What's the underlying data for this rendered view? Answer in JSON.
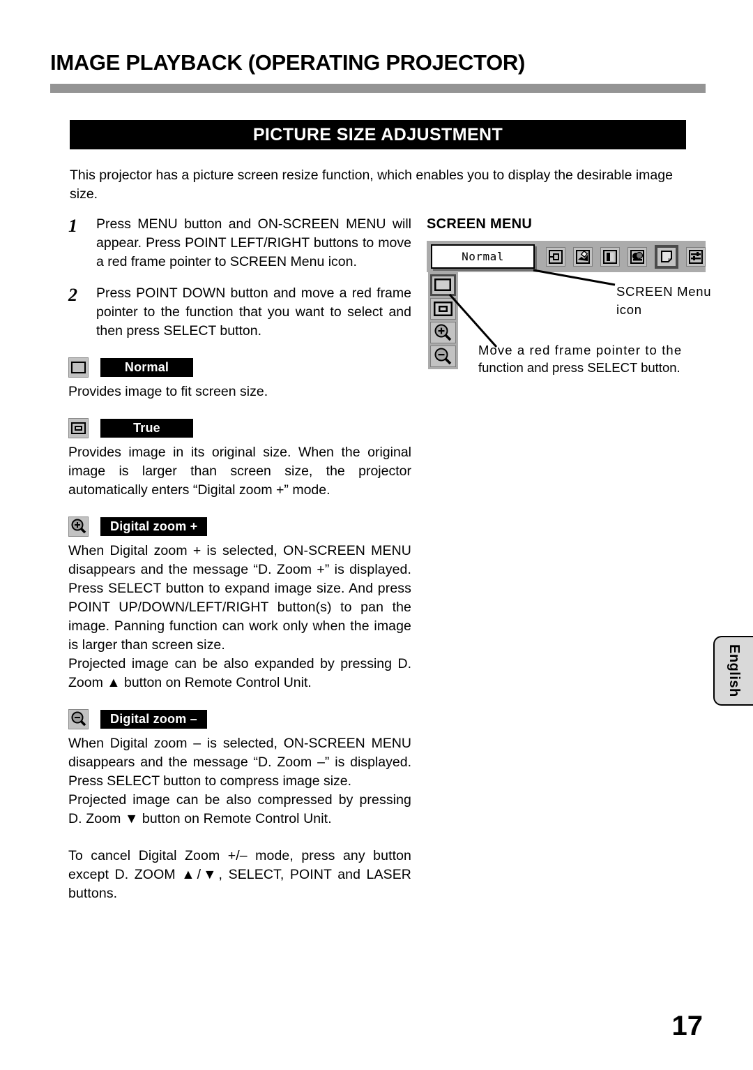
{
  "header": {
    "title": "IMAGE PLAYBACK (OPERATING PROJECTOR)",
    "section_banner": "PICTURE SIZE ADJUSTMENT"
  },
  "intro": "This projector has a picture screen resize function, which enables you to display the desirable image size.",
  "steps": [
    {
      "number": "1",
      "text": "Press MENU button and ON-SCREEN MENU will appear.  Press POINT LEFT/RIGHT buttons to move a red frame pointer to SCREEN Menu icon."
    },
    {
      "number": "2",
      "text": "Press POINT DOWN button and move a red frame pointer to the function that you want to select and then press SELECT button."
    }
  ],
  "functions": [
    {
      "icon": "normal-screen-icon",
      "badge": "Normal",
      "paragraphs": [
        "Provides image to fit screen size."
      ]
    },
    {
      "icon": "true-screen-icon",
      "badge": "True",
      "paragraphs": [
        "Provides image in its original size.  When the original image is larger than screen size, the projector automatically enters “Digital zoom +” mode."
      ]
    },
    {
      "icon": "digital-zoom-in-icon",
      "badge": "Digital zoom +",
      "paragraphs": [
        "When Digital zoom + is selected, ON-SCREEN MENU disappears and the message “D. Zoom +” is displayed.  Press SELECT button to expand image size.  And press POINT UP/DOWN/LEFT/RIGHT button(s) to pan the image.  Panning function can work only when the image is larger than screen size.",
        "Projected image can be also expanded by pressing D. Zoom ▲ button on Remote Control Unit."
      ]
    },
    {
      "icon": "digital-zoom-out-icon",
      "badge": "Digital zoom –",
      "paragraphs": [
        "When Digital zoom – is selected, ON-SCREEN MENU disappears and the message “D. Zoom –” is displayed.  Press SELECT button to compress image size.",
        "Projected image can be also compressed by pressing D. Zoom ▼ button on Remote Control Unit."
      ]
    }
  ],
  "closing_note": "To cancel Digital Zoom +/– mode, press any button except D. ZOOM ▲/▼, SELECT, POINT and LASER buttons.",
  "screen_menu_figure": {
    "label": "SCREEN MENU",
    "osd_value": "Normal",
    "menu_bar_icons": [
      {
        "name": "input-menu-icon",
        "selected": false
      },
      {
        "name": "image-adjust-menu-icon",
        "selected": false
      },
      {
        "name": "image-select-menu-icon",
        "selected": false
      },
      {
        "name": "pc-adjust-menu-icon",
        "selected": false
      },
      {
        "name": "screen-menu-icon",
        "selected": true
      },
      {
        "name": "setting-menu-icon",
        "selected": false
      }
    ],
    "submenu_icons": [
      {
        "name": "normal-screen-icon",
        "selected": true
      },
      {
        "name": "true-screen-icon",
        "selected": false
      },
      {
        "name": "digital-zoom-in-icon",
        "selected": false
      },
      {
        "name": "digital-zoom-out-icon",
        "selected": false
      }
    ],
    "callout_icon": "SCREEN Menu icon",
    "callout_move_line1": "Move a red frame pointer to the",
    "callout_move_line2": "function and press SELECT button."
  },
  "language_tab": "English",
  "page_number": "17",
  "colors": {
    "banner_bg": "#000000",
    "banner_text": "#ffffff",
    "rule_gray": "#949494",
    "osd_gray": "#ababab",
    "chip_gray": "#c2c2c2",
    "selected_border": "#4a4a4a",
    "tab_gray": "#d9d9d9"
  }
}
